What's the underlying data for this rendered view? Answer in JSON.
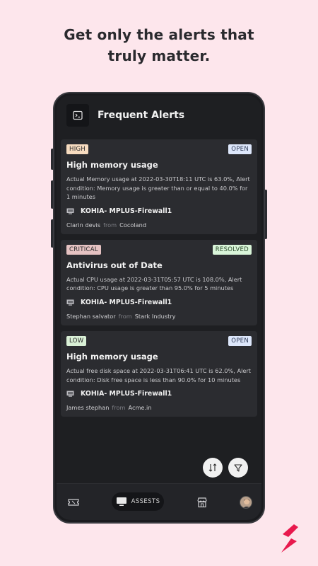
{
  "headline": {
    "line1": "Get only the alerts that",
    "line2": "truly matter."
  },
  "app": {
    "title": "Frequent Alerts",
    "header_icon": "terminal-icon"
  },
  "alerts": [
    {
      "severity": "HIGH",
      "status": "OPEN",
      "title": "High memory usage",
      "description": "Actual Memory usage at 2022-03-30T18:11 UTC is 63.0%, Alert condition: Memory usage is greater than or equal to 40.0% for 1 minutes",
      "asset": "KOHIA- MPLUS-Firewall1",
      "owner": "Clarin devis",
      "from_label": "from",
      "org": "Cocoland"
    },
    {
      "severity": "CRITICAL",
      "status": "RESOLVED",
      "title": "Antivirus out of Date",
      "description": "Actual CPU usage at 2022-03-31T05:57 UTC is 108.0%, Alert condition: CPU usage is greater than 95.0% for 5 minutes",
      "asset": "KOHIA- MPLUS-Firewall1",
      "owner": "Stephan salvator",
      "from_label": "from",
      "org": "Stark Industry"
    },
    {
      "severity": "LOW",
      "status": "OPEN",
      "title": "High memory usage",
      "description": "Actual free disk space at 2022-03-31T06:41 UTC is 62.0%, Alert condition: Disk free space is less than 90.0% for 10 minutes",
      "asset": "KOHIA- MPLUS-Firewall1",
      "owner": "James stephan",
      "from_label": "from",
      "org": "Acme.in"
    }
  ],
  "fabs": {
    "sort_icon": "sort-icon",
    "filter_icon": "filter-icon"
  },
  "bottom_nav": {
    "tickets_icon": "ticket-icon",
    "assets_label": "ASSESTS",
    "assets_icon": "monitor-icon",
    "store_icon": "store-icon",
    "profile_icon": "avatar"
  },
  "colors": {
    "page_bg": "#fde6ec",
    "card_bg": "#2b2c30",
    "high": "#f7dcc0",
    "critical": "#e5c2c2",
    "low": "#d9f0d6",
    "open": "#dde7fb",
    "resolved": "#d9f5d9",
    "brand": "#e8194d"
  }
}
